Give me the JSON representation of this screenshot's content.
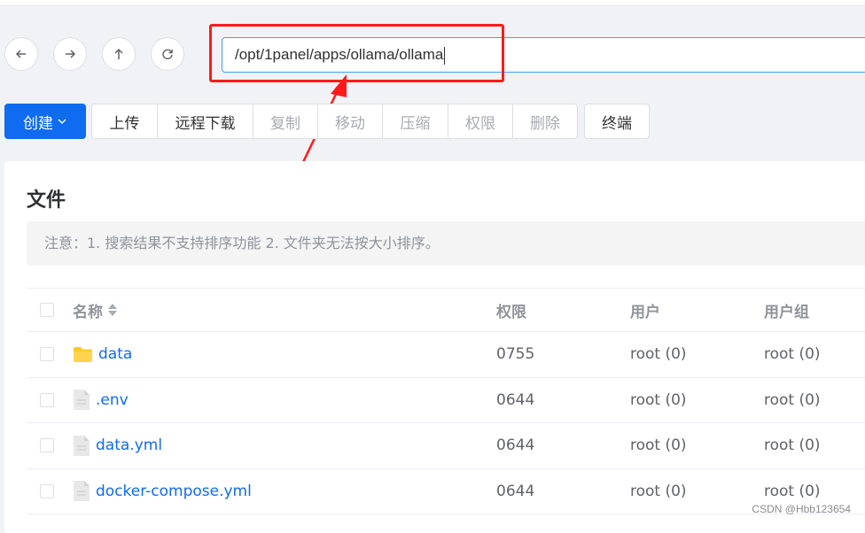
{
  "nav": {
    "back_icon": "arrow-left-icon",
    "forward_icon": "arrow-right-icon",
    "up_icon": "arrow-up-icon",
    "refresh_icon": "refresh-icon"
  },
  "path": {
    "value": "/opt/1panel/apps/ollama/ollama"
  },
  "toolbar": {
    "create_label": "创建",
    "upload_label": "上传",
    "remote_download_label": "远程下载",
    "copy_label": "复制",
    "move_label": "移动",
    "compress_label": "压缩",
    "permission_label": "权限",
    "delete_label": "删除",
    "terminal_label": "终端"
  },
  "panel": {
    "title": "文件",
    "notice": "注意：1. 搜索结果不支持排序功能 2. 文件夹无法按大小排序。"
  },
  "table": {
    "headers": {
      "name": "名称",
      "permission": "权限",
      "user": "用户",
      "group": "用户组"
    },
    "rows": [
      {
        "name": "data",
        "type": "folder",
        "permission": "0755",
        "user": "root (0)",
        "group": "root (0)"
      },
      {
        "name": ".env",
        "type": "file",
        "permission": "0644",
        "user": "root (0)",
        "group": "root (0)"
      },
      {
        "name": "data.yml",
        "type": "file",
        "permission": "0644",
        "user": "root (0)",
        "group": "root (0)"
      },
      {
        "name": "docker-compose.yml",
        "type": "file",
        "permission": "0644",
        "user": "root (0)",
        "group": "root (0)"
      }
    ]
  },
  "colors": {
    "primary": "#0f6bf0",
    "highlight": "#ff1a1a",
    "folder": "#ffca28"
  },
  "watermark": "CSDN @Hbb123654"
}
